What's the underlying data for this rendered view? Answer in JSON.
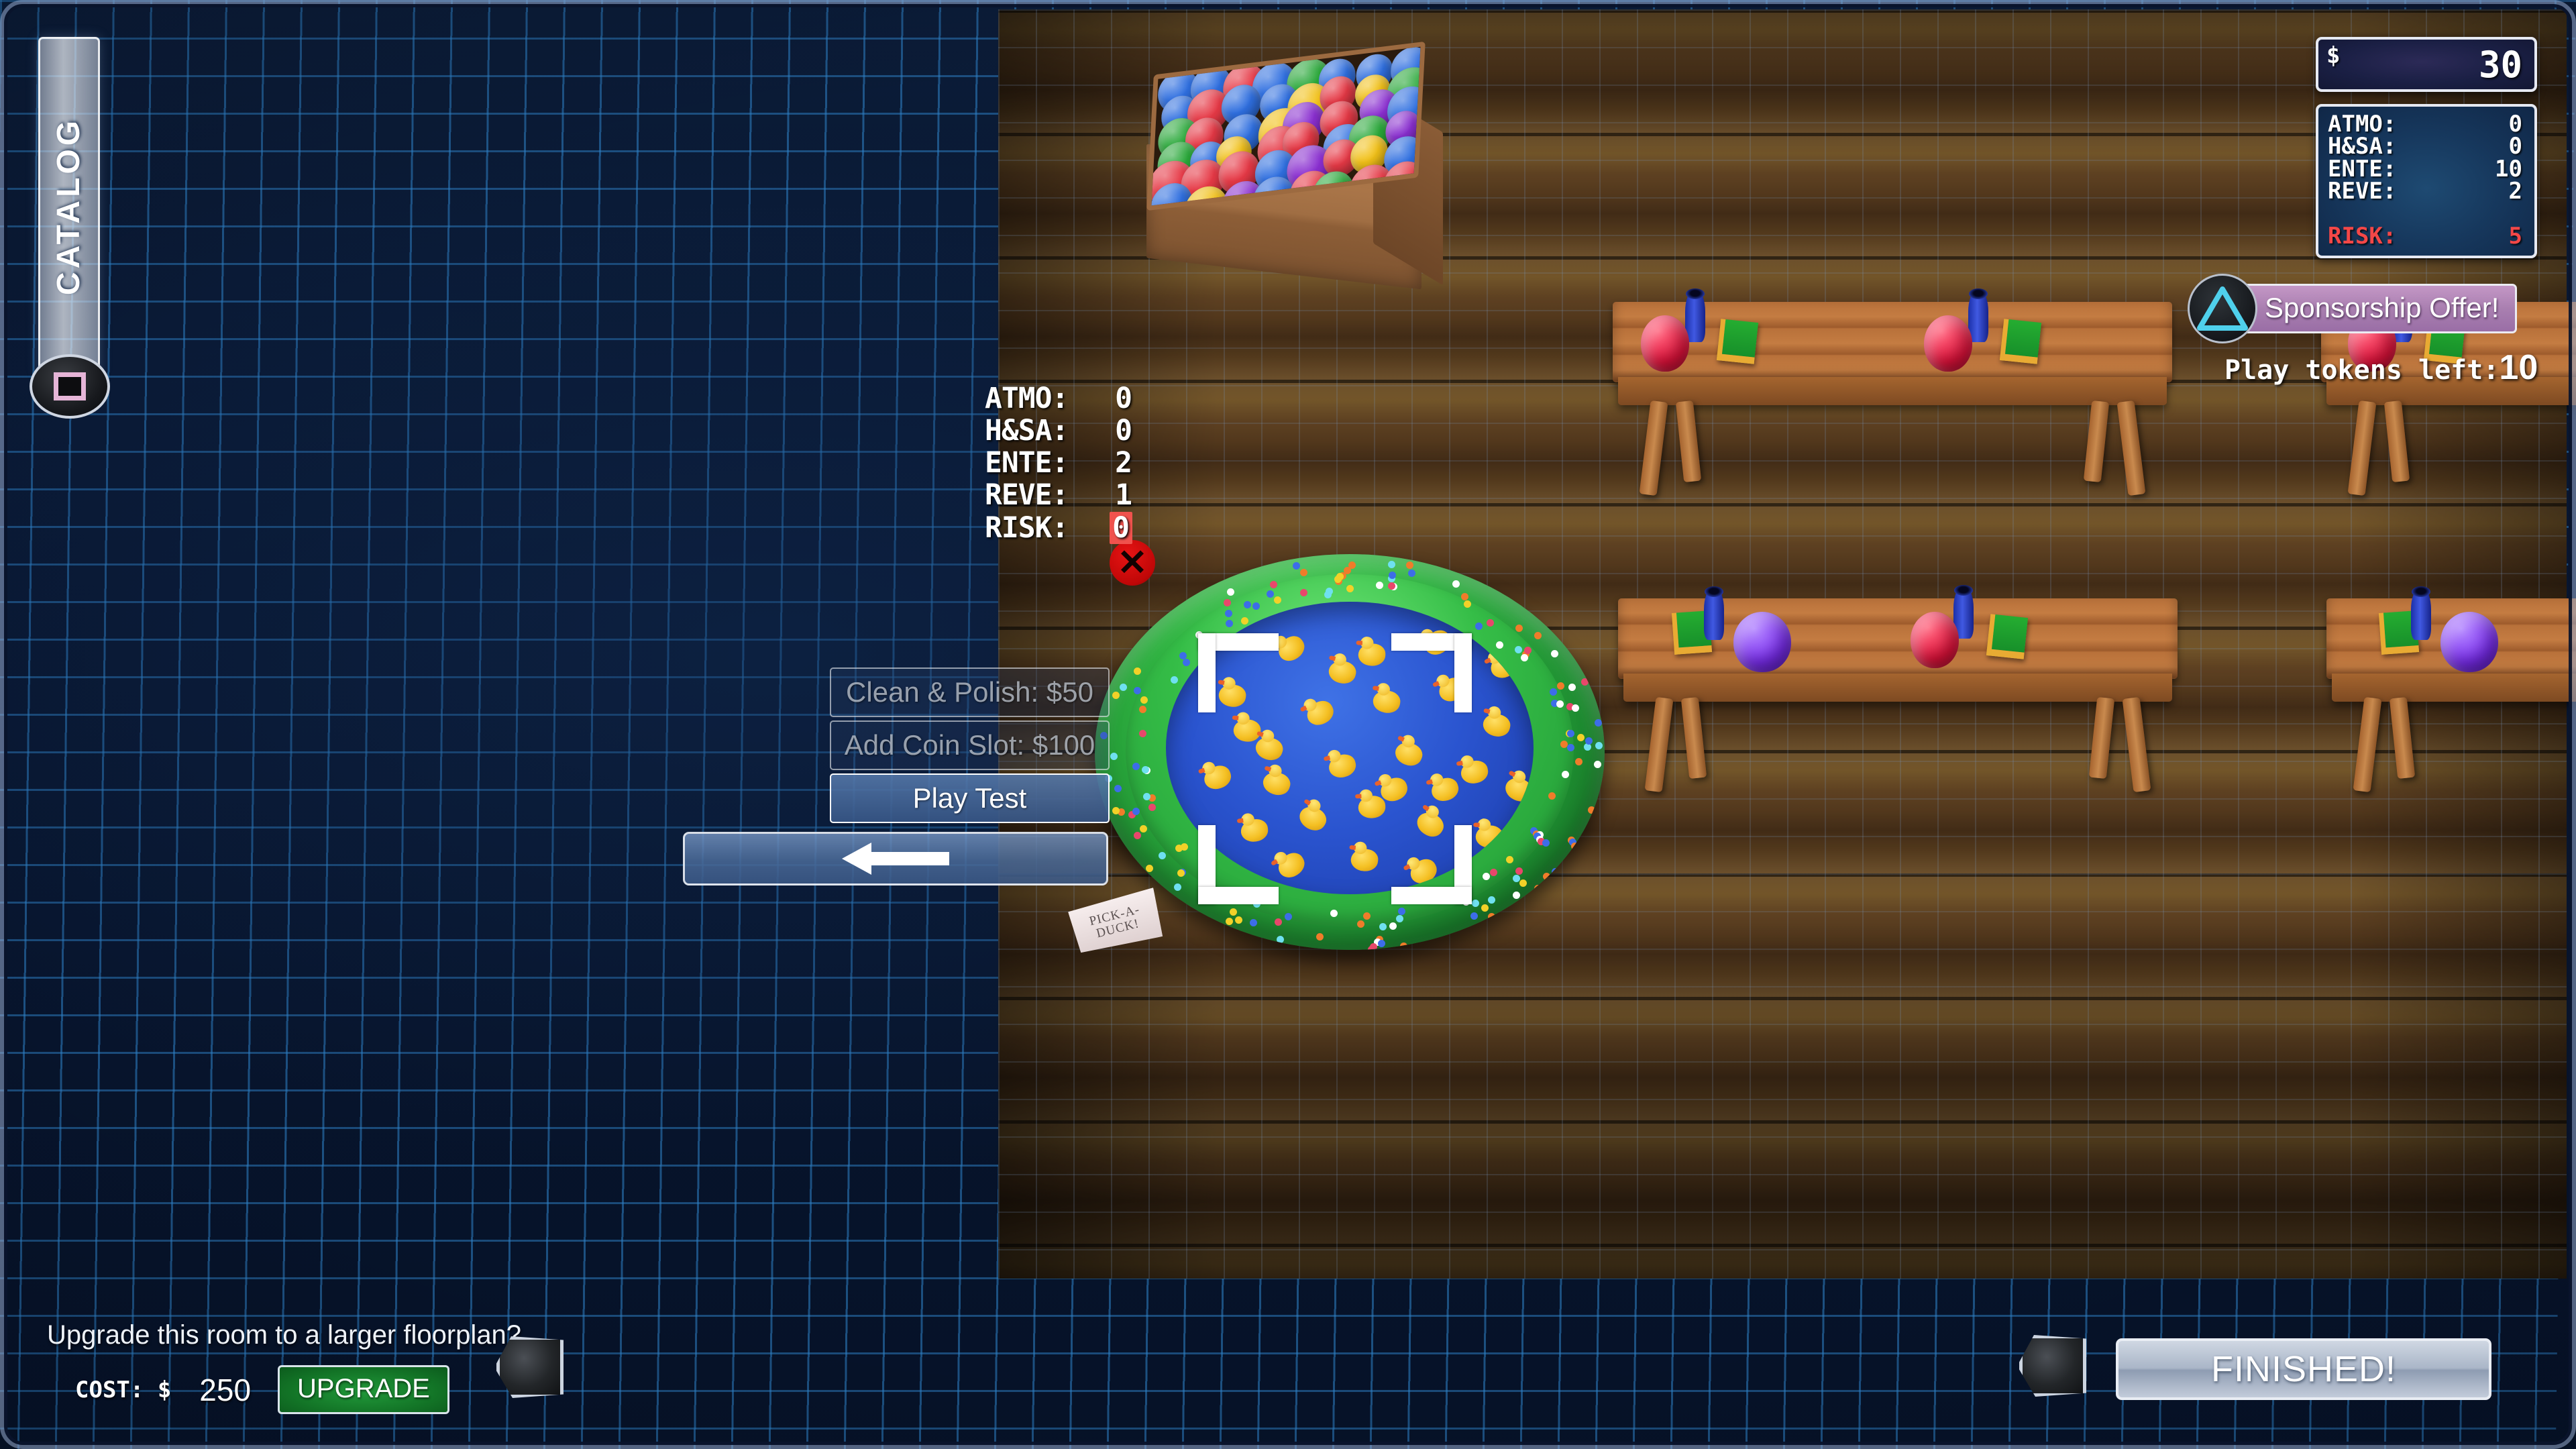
{
  "hud": {
    "money": {
      "currency_symbol": "$",
      "amount": "30"
    },
    "stats_panel": {
      "rows": [
        {
          "label": "ATMO:",
          "value": "0"
        },
        {
          "label": "H&SA:",
          "value": "0"
        },
        {
          "label": "ENTE:",
          "value": "10"
        },
        {
          "label": "REVE:",
          "value": "2"
        }
      ],
      "risk": {
        "label": "RISK:",
        "value": "5",
        "color": "#f44747"
      }
    },
    "sponsorship": {
      "label": "Sponsorship Offer!",
      "icon": "triangle-icon",
      "accent": "#a97fb0"
    },
    "play_tokens": {
      "label": "Play tokens left:",
      "value": "10"
    }
  },
  "catalog": {
    "label": "CATALOG",
    "knob_icon": "square-icon"
  },
  "selected_prop": {
    "name": "PICK-A-DUCK!",
    "sign_line1": "PICK-A-",
    "sign_line2": "DUCK!",
    "delete_icon": "close-x-icon",
    "stats": {
      "rows": [
        {
          "label": "ATMO:",
          "value": "0"
        },
        {
          "label": "H&SA:",
          "value": "0"
        },
        {
          "label": "ENTE:",
          "value": "2"
        },
        {
          "label": "REVE:",
          "value": "1"
        }
      ],
      "risk": {
        "label": "RISK:",
        "value": "0",
        "highlight": "#f0524d"
      }
    }
  },
  "context_menu": {
    "items": [
      {
        "label": "Clean & Polish: $50",
        "enabled": false
      },
      {
        "label": "Add Coin Slot: $100",
        "enabled": false
      },
      {
        "label": "Play Test",
        "enabled": true
      }
    ],
    "back_icon": "arrow-left-icon"
  },
  "upgrade": {
    "question": "Upgrade this room to a larger floorplan?",
    "cost_label": "COST: $",
    "cost_value": "250",
    "button_label": "UPGRADE",
    "button_color": "#159030"
  },
  "footer": {
    "finished_label": "FINISHED!"
  },
  "scene": {
    "props": [
      {
        "name": "ball-pit-crate",
        "type": "ball-pit"
      },
      {
        "name": "prize-bench-1",
        "type": "bench",
        "items": [
          "balloon-red",
          "cup-blue",
          "book-green",
          "balloon-red",
          "cup-blue",
          "book-green"
        ]
      },
      {
        "name": "prize-bench-2",
        "type": "bench",
        "items": [
          "cup-blue",
          "book-green",
          "balloon-purple",
          "balloon-red",
          "cup-blue",
          "book-green"
        ]
      },
      {
        "name": "prize-bench-3",
        "type": "bench",
        "items": [
          "balloon-red",
          "cup-blue",
          "book-green"
        ]
      },
      {
        "name": "prize-bench-4",
        "type": "bench",
        "items": [
          "cup-blue",
          "book-green",
          "balloon-purple"
        ]
      },
      {
        "name": "pick-a-duck-pool",
        "type": "duck-pool",
        "selected": true
      }
    ],
    "colors": {
      "floor": "#6a4b28",
      "blueprint": "#081630",
      "grid_line": "#2e82c8",
      "pool_ring": "#2fb341",
      "pool_water": "#2a54cf",
      "duck": "#f4bf22"
    }
  }
}
